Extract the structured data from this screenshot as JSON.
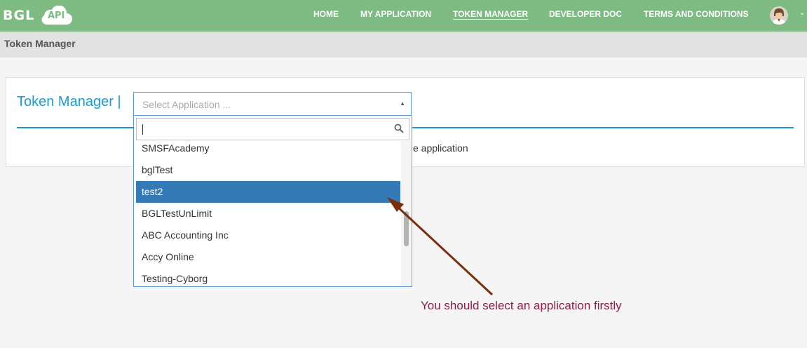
{
  "brand": {
    "name": "BGL",
    "cloud_label": "API",
    "accent_color": "#7dbb83",
    "link_color": "#1a9bd2",
    "highlight_color": "#337ab7"
  },
  "nav": {
    "items": [
      {
        "label": "HOME"
      },
      {
        "label": "MY APPLICATION"
      },
      {
        "label": "TOKEN MANAGER",
        "active": true
      },
      {
        "label": "DEVELOPER DOC"
      },
      {
        "label": "TERMS AND CONDITIONS"
      }
    ],
    "avatar_icon": "user-avatar-icon",
    "menu_icon": "chevron-down-icon"
  },
  "subheader": {
    "title": "Token Manager"
  },
  "card": {
    "title": "Token Manager |",
    "note": "e application"
  },
  "select": {
    "placeholder": "Select Application ...",
    "search_value": "",
    "options": [
      {
        "label": "SMSFAcademy"
      },
      {
        "label": "bglTest"
      },
      {
        "label": "test2",
        "highlighted": true
      },
      {
        "label": "BGLTestUnLimit"
      },
      {
        "label": "ABC Accounting Inc"
      },
      {
        "label": "Accy Online"
      },
      {
        "label": "Testing-Cyborg"
      }
    ]
  },
  "annotation": {
    "text": "You should select an application firstly",
    "color": "#8b1d46"
  }
}
